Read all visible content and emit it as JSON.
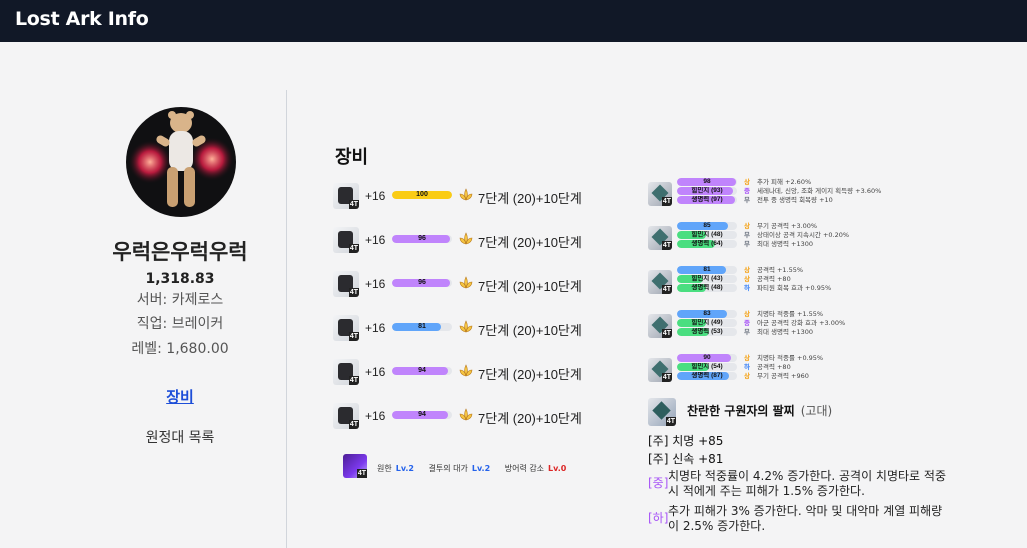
{
  "app": {
    "title": "Lost Ark Info"
  },
  "profile": {
    "name": "우럭은우럭우럭",
    "item_level": "1,318.83",
    "server": "서버: 카제로스",
    "job": "직업: 브레이커",
    "level": "레벨: 1,680.00"
  },
  "nav": {
    "equipment": "장비",
    "expedition": "원정대 목록"
  },
  "section": {
    "equipment_title": "장비"
  },
  "equipment": [
    {
      "name": "weapon",
      "tier": "4T",
      "upgrade": "+16",
      "quality": 100,
      "quality_color": "#facc15",
      "text": "7단계 (20)+10단계"
    },
    {
      "name": "helmet",
      "tier": "4T",
      "upgrade": "+16",
      "quality": 96,
      "quality_color": "#c084fc",
      "text": "7단계 (20)+10단계"
    },
    {
      "name": "chest",
      "tier": "4T",
      "upgrade": "+16",
      "quality": 96,
      "quality_color": "#c084fc",
      "text": "7단계 (20)+10단계"
    },
    {
      "name": "pants",
      "tier": "4T",
      "upgrade": "+16",
      "quality": 81,
      "quality_color": "#60a5fa",
      "text": "7단계 (20)+10단계"
    },
    {
      "name": "gloves",
      "tier": "4T",
      "upgrade": "+16",
      "quality": 94,
      "quality_color": "#c084fc",
      "text": "7단계 (20)+10단계"
    },
    {
      "name": "shoulders",
      "tier": "4T",
      "upgrade": "+16",
      "quality": 94,
      "quality_color": "#c084fc",
      "text": "7단계 (20)+10단계"
    }
  ],
  "engravings": {
    "tier": "4T",
    "items": [
      {
        "name": "원한",
        "level": "Lv.2",
        "color": "#2563eb"
      },
      {
        "name": "결투의 대가",
        "level": "Lv.2",
        "color": "#2563eb"
      },
      {
        "name": "방어력 감소",
        "level": "Lv.0",
        "color": "#dc2626"
      }
    ]
  },
  "accessories": [
    {
      "name": "necklace",
      "tier": "4T",
      "bars": [
        {
          "text": "98",
          "fill": 0.98,
          "color": "#c084fc"
        },
        {
          "text": "힘민지 (93)",
          "fill": 0.93,
          "color": "#c084fc"
        },
        {
          "text": "생명력 (97)",
          "fill": 0.97,
          "color": "#c084fc"
        }
      ],
      "effects": [
        {
          "grade": "상",
          "grade_color": "#f59e0b",
          "text": "추가 피해 +2.60%"
        },
        {
          "grade": "중",
          "grade_color": "#a855f7",
          "text": "세레나데, 신앙, 조화 게이지 획득량 +3.60%"
        },
        {
          "grade": "무",
          "grade_color": "#6b7280",
          "text": "전투 중 생명력 회복량 +10"
        }
      ]
    },
    {
      "name": "earring-1",
      "tier": "4T",
      "bars": [
        {
          "text": "85",
          "fill": 0.85,
          "color": "#60a5fa"
        },
        {
          "text": "힘민지 (48)",
          "fill": 0.48,
          "color": "#4ade80"
        },
        {
          "text": "생명력 (64)",
          "fill": 0.64,
          "color": "#4ade80"
        }
      ],
      "effects": [
        {
          "grade": "상",
          "grade_color": "#f59e0b",
          "text": "무기 공격력 +3.00%"
        },
        {
          "grade": "무",
          "grade_color": "#6b7280",
          "text": "상태이상 공격 지속시간 +0.20%"
        },
        {
          "grade": "무",
          "grade_color": "#6b7280",
          "text": "최대 생명력 +1300"
        }
      ]
    },
    {
      "name": "earring-2",
      "tier": "4T",
      "bars": [
        {
          "text": "81",
          "fill": 0.81,
          "color": "#60a5fa"
        },
        {
          "text": "힘민지 (43)",
          "fill": 0.43,
          "color": "#4ade80"
        },
        {
          "text": "생명력 (48)",
          "fill": 0.48,
          "color": "#4ade80"
        }
      ],
      "effects": [
        {
          "grade": "상",
          "grade_color": "#f59e0b",
          "text": "공격력 +1.55%"
        },
        {
          "grade": "상",
          "grade_color": "#f59e0b",
          "text": "공격력 +80"
        },
        {
          "grade": "하",
          "grade_color": "#3b82f6",
          "text": "파티원 회복 효과 +0.95%"
        }
      ]
    },
    {
      "name": "ring-1",
      "tier": "4T",
      "bars": [
        {
          "text": "83",
          "fill": 0.83,
          "color": "#60a5fa"
        },
        {
          "text": "힘민지 (49)",
          "fill": 0.49,
          "color": "#4ade80"
        },
        {
          "text": "생명력 (53)",
          "fill": 0.53,
          "color": "#4ade80"
        }
      ],
      "effects": [
        {
          "grade": "상",
          "grade_color": "#f59e0b",
          "text": "치명타 적중률 +1.55%"
        },
        {
          "grade": "중",
          "grade_color": "#a855f7",
          "text": "아군 공격력 강화 효과 +3.00%"
        },
        {
          "grade": "무",
          "grade_color": "#6b7280",
          "text": "최대 생명력 +1300"
        }
      ]
    },
    {
      "name": "ring-2",
      "tier": "4T",
      "bars": [
        {
          "text": "90",
          "fill": 0.9,
          "color": "#c084fc"
        },
        {
          "text": "힘민지 (54)",
          "fill": 0.54,
          "color": "#4ade80"
        },
        {
          "text": "생명력 (87)",
          "fill": 0.87,
          "color": "#60a5fa"
        }
      ],
      "effects": [
        {
          "grade": "상",
          "grade_color": "#f59e0b",
          "text": "치명타 적중률 +0.95%"
        },
        {
          "grade": "하",
          "grade_color": "#3b82f6",
          "text": "공격력 +80"
        },
        {
          "grade": "상",
          "grade_color": "#f59e0b",
          "text": "무기 공격력 +960"
        }
      ]
    }
  ],
  "bracelet": {
    "tier": "4T",
    "name": "찬란한 구원자의 팔찌",
    "grade": "(고대)",
    "stats": [
      "[주] 치명 +85",
      "[주] 신속 +81"
    ],
    "effects": [
      {
        "tag": "[중]",
        "text": "치명타 적중률이 4.2% 증가한다. 공격이 치명타로 적중 시 적에게 주는 피해가 1.5% 증가한다."
      },
      {
        "tag": "[하]",
        "text": "추가 피해가 3% 증가한다. 악마 및 대악마 계열 피해량이 2.5% 증가한다."
      }
    ]
  }
}
